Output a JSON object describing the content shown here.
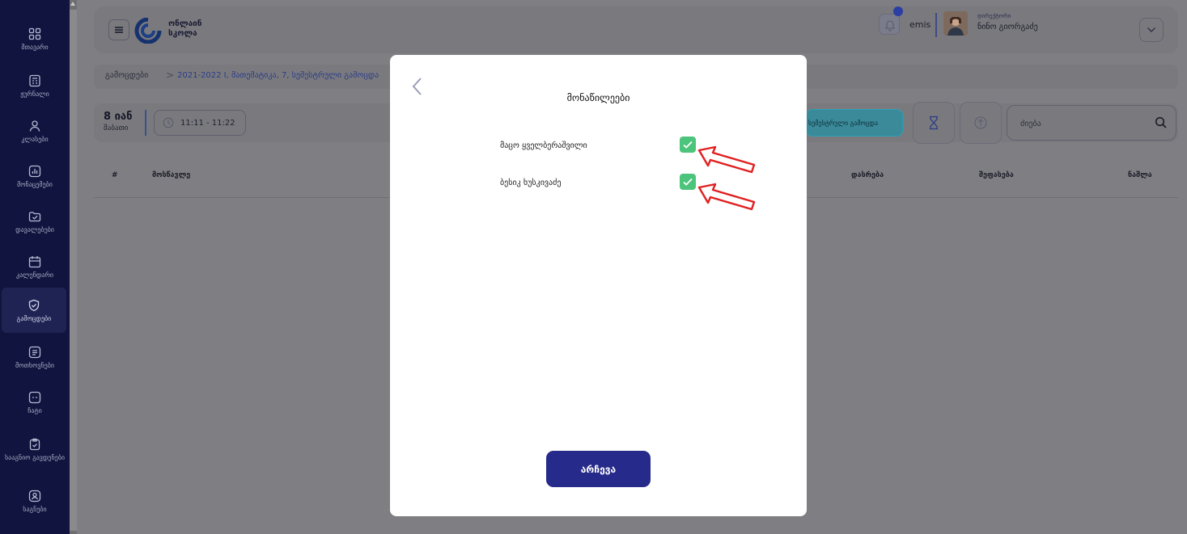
{
  "sidebar": {
    "items": [
      {
        "label": "მთავარი",
        "icon": "grid-icon"
      },
      {
        "label": "ჟურნალი",
        "icon": "journal-icon"
      },
      {
        "label": "კლასები",
        "icon": "user-icon"
      },
      {
        "label": "მონაცემები",
        "icon": "chart-icon"
      },
      {
        "label": "დავალებები",
        "icon": "folder-check-icon"
      },
      {
        "label": "კალენდარი",
        "icon": "calendar-icon"
      },
      {
        "label": "გამოცდები",
        "icon": "shield-check-icon"
      },
      {
        "label": "მოთხოვნები",
        "icon": "document-icon"
      },
      {
        "label": "ჩატი",
        "icon": "chat-icon"
      },
      {
        "label": "სააგნიო გავდენები",
        "icon": "clipboard-check-icon"
      },
      {
        "label": "საგნები",
        "icon": "book-icon"
      }
    ],
    "active_index": 6
  },
  "header": {
    "logo_line1": "ონლაინ",
    "logo_line2": "სკოლა",
    "user_short": "emis",
    "user_role": "დირექტორი",
    "user_name": "ნინო გიორგაძე"
  },
  "breadcrumb": {
    "root": "გამოცდები",
    "separator": ">",
    "current": "2021-2022 I, მათემატიკა, 7, სემესტრული გამოცდა"
  },
  "toolbar": {
    "date_main": "8 იან",
    "date_sub": "შაბათი",
    "time_range": "11:11 - 11:22",
    "exam_button": "სემესტრული გამოცდა",
    "search_placeholder": "ძიება"
  },
  "table": {
    "headers": [
      "#",
      "მოსწავლე",
      "დასრება",
      "შეფასება",
      "ნაშლა"
    ]
  },
  "modal": {
    "title": "მონაწილეები",
    "participants": [
      {
        "name": "მაცო ყველბერაშვილი",
        "checked": true
      },
      {
        "name": "ბესიკ ხუსკივაძე",
        "checked": true
      }
    ],
    "choose_button": "არჩევა"
  },
  "colors": {
    "modal_bg": "#ffffff",
    "check_green": "#4cc47b",
    "primary_button": "#262a8a",
    "annotation_red": "#e02020",
    "sidebar_bg": "#10143f"
  }
}
